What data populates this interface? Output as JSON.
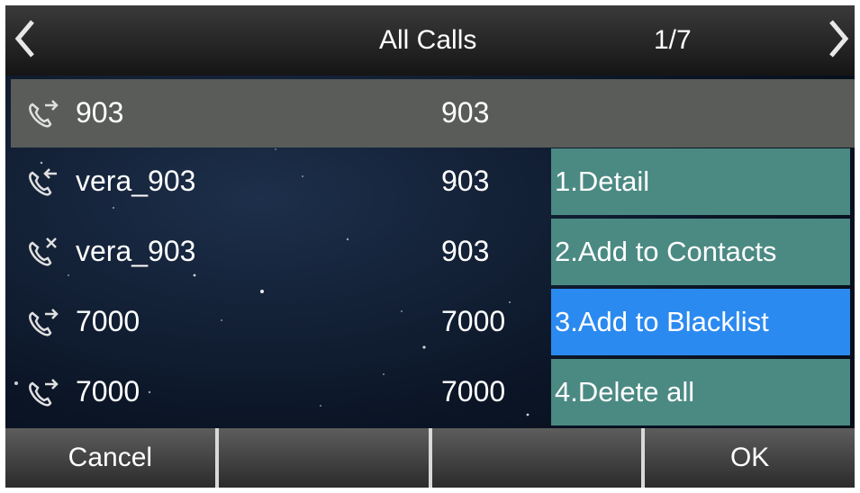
{
  "header": {
    "title": "All Calls",
    "page": "1/7"
  },
  "calls": [
    {
      "icon": "outgoing-call-icon",
      "name": "903",
      "number": "903"
    },
    {
      "icon": "incoming-call-icon",
      "name": "vera_903",
      "number": "903"
    },
    {
      "icon": "missed-call-icon",
      "name": "vera_903",
      "number": "903"
    },
    {
      "icon": "outgoing-call-icon",
      "name": "7000",
      "number": "7000"
    },
    {
      "icon": "outgoing-call-icon",
      "name": "7000",
      "number": "7000"
    }
  ],
  "menu": [
    {
      "label": "1.Detail"
    },
    {
      "label": "2.Add to Contacts"
    },
    {
      "label": "3.Add to Blacklist"
    },
    {
      "label": "4.Delete all"
    }
  ],
  "softkeys": {
    "k1": "Cancel",
    "k2": "",
    "k3": "",
    "k4": "OK"
  },
  "colors": {
    "selected_row": "#595c58",
    "menu_item": "#4b8a83",
    "menu_active": "#2b8af0"
  }
}
